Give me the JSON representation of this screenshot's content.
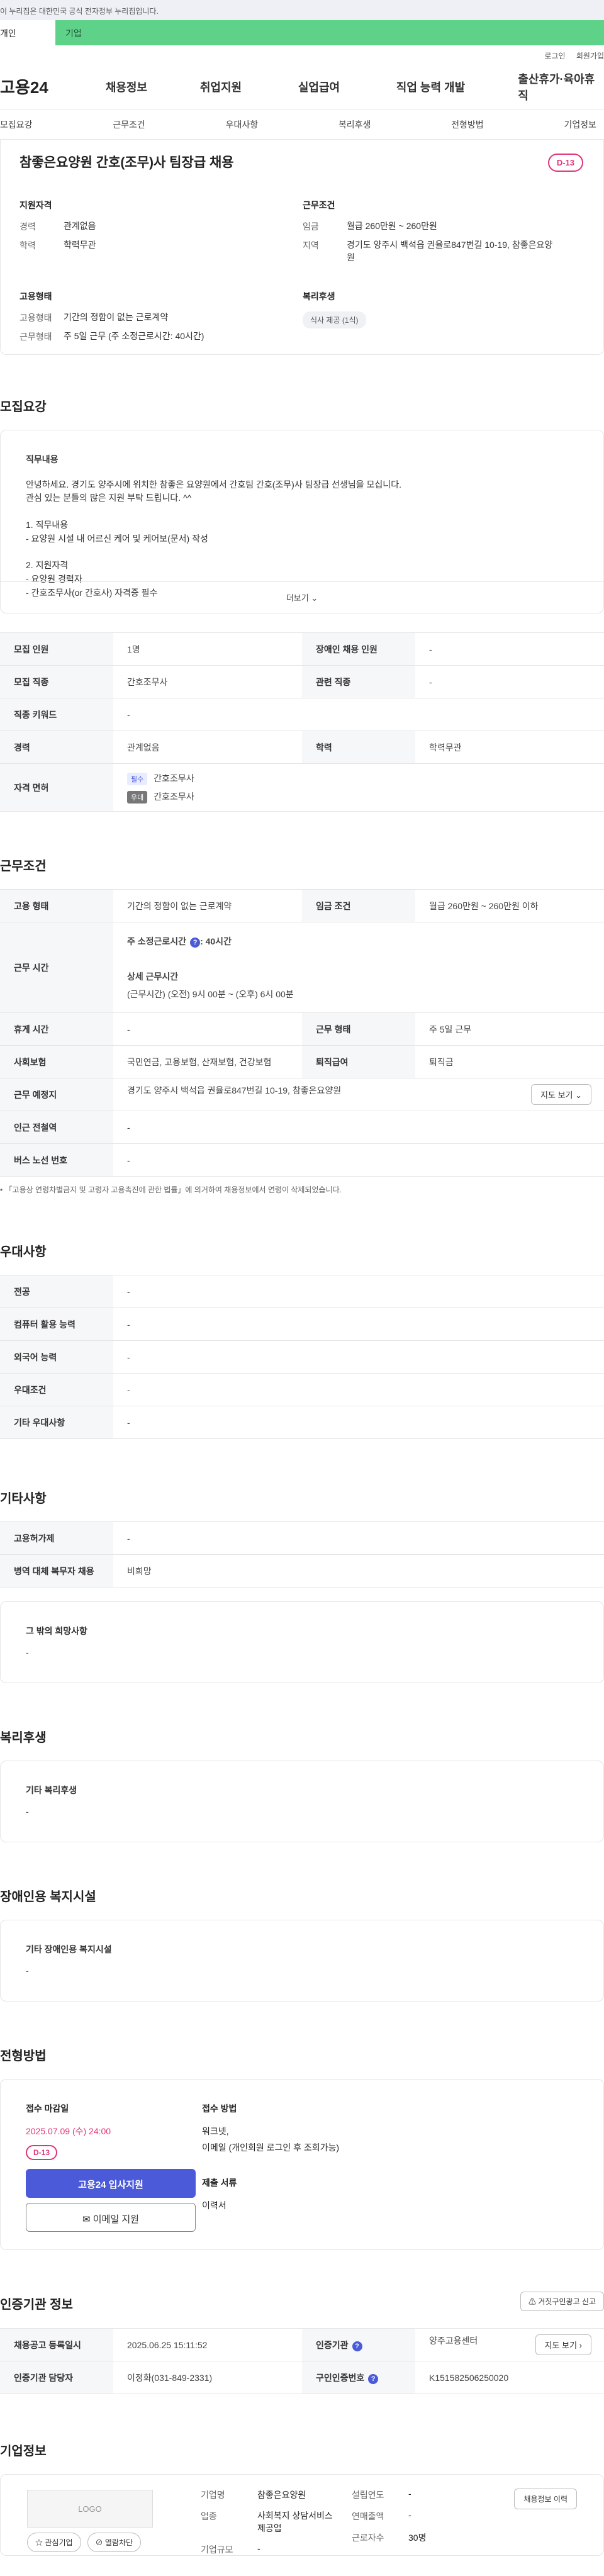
{
  "gov_banner": "이 누리집은 대한민국 공식 전자정부 누리집입니다.",
  "user_tabs": [
    "개인",
    "기업"
  ],
  "util_links": [
    "로그인",
    "회원가입"
  ],
  "logo": "고용24",
  "gnb": [
    "채용정보",
    "취업지원",
    "실업급여",
    "직업 능력 개발",
    "출산휴가·육아휴직"
  ],
  "sub_tabs": [
    "모집요강",
    "근무조건",
    "우대사항",
    "복리후생",
    "전형방법",
    "기업정보"
  ],
  "job": {
    "title": "참좋은요양원 간호(조무)사 팀장급 채용",
    "dday": "D-13",
    "qual_h": "지원자격",
    "qual": [
      {
        "k": "경력",
        "v": "관계없음"
      },
      {
        "k": "학력",
        "v": "학력무관"
      }
    ],
    "cond_h": "근무조건",
    "cond": [
      {
        "k": "임금",
        "v": "월급 260만원 ~ 260만원"
      },
      {
        "k": "지역",
        "v": "경기도 양주시 백석읍 권율로847번길 10-19, 참좋은요양원"
      }
    ],
    "emp_h": "고용형태",
    "emp": [
      {
        "k": "고용형태",
        "v": "기간의 정함이 없는 근로계약"
      },
      {
        "k": "근무형태",
        "v": "주 5일 근무 (주 소정근로시간: 40시간)"
      }
    ],
    "welfare_h": "복리후생",
    "welfare_chip": "식사 제공 (1식)"
  },
  "recruit": {
    "title": "모집요강",
    "duty_h": "직무내용",
    "duty_lines": [
      "안녕하세요. 경기도 양주시에 위치한 참좋은 요양원에서 간호팀 간호(조무)사 팀장급 선생님을 모십니다.",
      "관심 있는 분들의 많은 지원 부탁 드립니다. ^^",
      "",
      "1. 직무내용",
      "- 요양원 시설 내 어르신 케어 및 케어보(문서) 작성",
      "",
      "2. 지원자격",
      "- 요양원 경력자",
      "- 간호조무사(or 간호사) 자격증 필수"
    ],
    "more": "더보기",
    "rows": [
      {
        "k1": "모집 인원",
        "v1": "1명",
        "k2": "장애인 채용 인원",
        "v2": "-"
      },
      {
        "k1": "모집 직종",
        "v1": "간호조무사",
        "k2": "관련 직종",
        "v2": "-"
      },
      {
        "k1": "직종 키워드",
        "v1": "-"
      },
      {
        "k1": "경력",
        "v1": "관계없음",
        "k2": "학력",
        "v2": "학력무관"
      }
    ],
    "license_k": "자격 면허",
    "license": [
      {
        "tag": "필수",
        "v": "간호조무사"
      },
      {
        "tag": "우대",
        "v": "간호조무사"
      }
    ]
  },
  "work": {
    "title": "근무조건",
    "emp_k": "고용 형태",
    "emp_v": "기간의 정함이 없는 근로계약",
    "wage_k": "임금 조건",
    "wage_v": "월급 260만원 ~ 260만원 이하",
    "hours_k": "근무 시간",
    "hours_main": "주 소정근로시간",
    "hours_val": ": 40시간",
    "hours_detail_h": "상세 근무시간",
    "hours_detail": "(근무시간) (오전) 9시 00분 ~ (오후) 6시 00분",
    "rest_k": "휴게 시간",
    "rest_v": "-",
    "type_k": "근무 형태",
    "type_v": "주 5일 근무",
    "ins_k": "사회보험",
    "ins_v": "국민연금, 고용보험, 산재보험, 건강보험",
    "sev_k": "퇴직급여",
    "sev_v": "퇴직금",
    "place_k": "근무 예정지",
    "place_v": "경기도 양주시 백석읍 권율로847번길 10-19, 참좋은요양원",
    "map_btn": "지도 보기",
    "subway_k": "인근 전철역",
    "subway_v": "-",
    "bus_k": "버스 노선 번호",
    "bus_v": "-",
    "note": "「고용상 연령차별금지 및 고령자 고용촉진에 관한 법률」에 의거하여 채용정보에서 연령이 삭제되었습니다."
  },
  "pref": {
    "title": "우대사항",
    "rows": [
      {
        "k": "전공",
        "v": "-"
      },
      {
        "k": "컴퓨터 활용 능력",
        "v": "-"
      },
      {
        "k": "외국어 능력",
        "v": "-"
      },
      {
        "k": "우대조건",
        "v": "-"
      },
      {
        "k": "기타 우대사항",
        "v": "-"
      }
    ]
  },
  "etc": {
    "title": "기타사항",
    "rows": [
      {
        "k": "고용허가제",
        "v": "-"
      },
      {
        "k": "병역 대체 복무자 채용",
        "v": "비희망"
      }
    ],
    "box_h": "그 밖의 희망사항",
    "box_v": "-"
  },
  "welfare": {
    "title": "복리후생",
    "box_h": "기타 복리후생",
    "box_v": "-"
  },
  "disabled": {
    "title": "장애인용 복지시설",
    "box_h": "기타 장애인용 복지시설",
    "box_v": "-"
  },
  "screening": {
    "title": "전형방법",
    "deadline_h": "접수 마감일",
    "deadline": "2025.07.09 (수) 24:00",
    "dday": "D-13",
    "apply_btn": "고용24 입사지원",
    "email_btn": "이메일 지원",
    "method_h": "접수 방법",
    "method": [
      "워크넷,",
      "이메일 (개인회원 로그인 후 조회가능)"
    ],
    "docs_h": "제출 서류",
    "docs": "이력서"
  },
  "agency": {
    "title": "인증기관 정보",
    "report_btn": "거짓구인광고 신고",
    "reg_k": "채용공고 등록일시",
    "reg_v": "2025.06.25 15:11:52",
    "org_k": "인증기관",
    "org_v": "양주고용센터",
    "map_btn": "지도 보기",
    "mgr_k": "인증기관 담당자",
    "mgr_v": "이정화(031-849-2331)",
    "no_k": "구인인증번호",
    "no_v": "K151582506250020"
  },
  "company": {
    "title": "기업정보",
    "logo": "LOGO",
    "interest_btn": "관심기업",
    "block_btn": "열람차단",
    "name_k": "기업명",
    "name_v": "참좋은요양원",
    "industry_k": "업종",
    "industry_v": "사회복지 상담서비스 제공업",
    "size_k": "기업규모",
    "size_v": "-",
    "founded_k": "설립연도",
    "founded_v": "-",
    "sales_k": "연매출액",
    "sales_v": "-",
    "workers_k": "근로자수",
    "workers_v": "30명",
    "history_btn": "채용정보 이력"
  }
}
